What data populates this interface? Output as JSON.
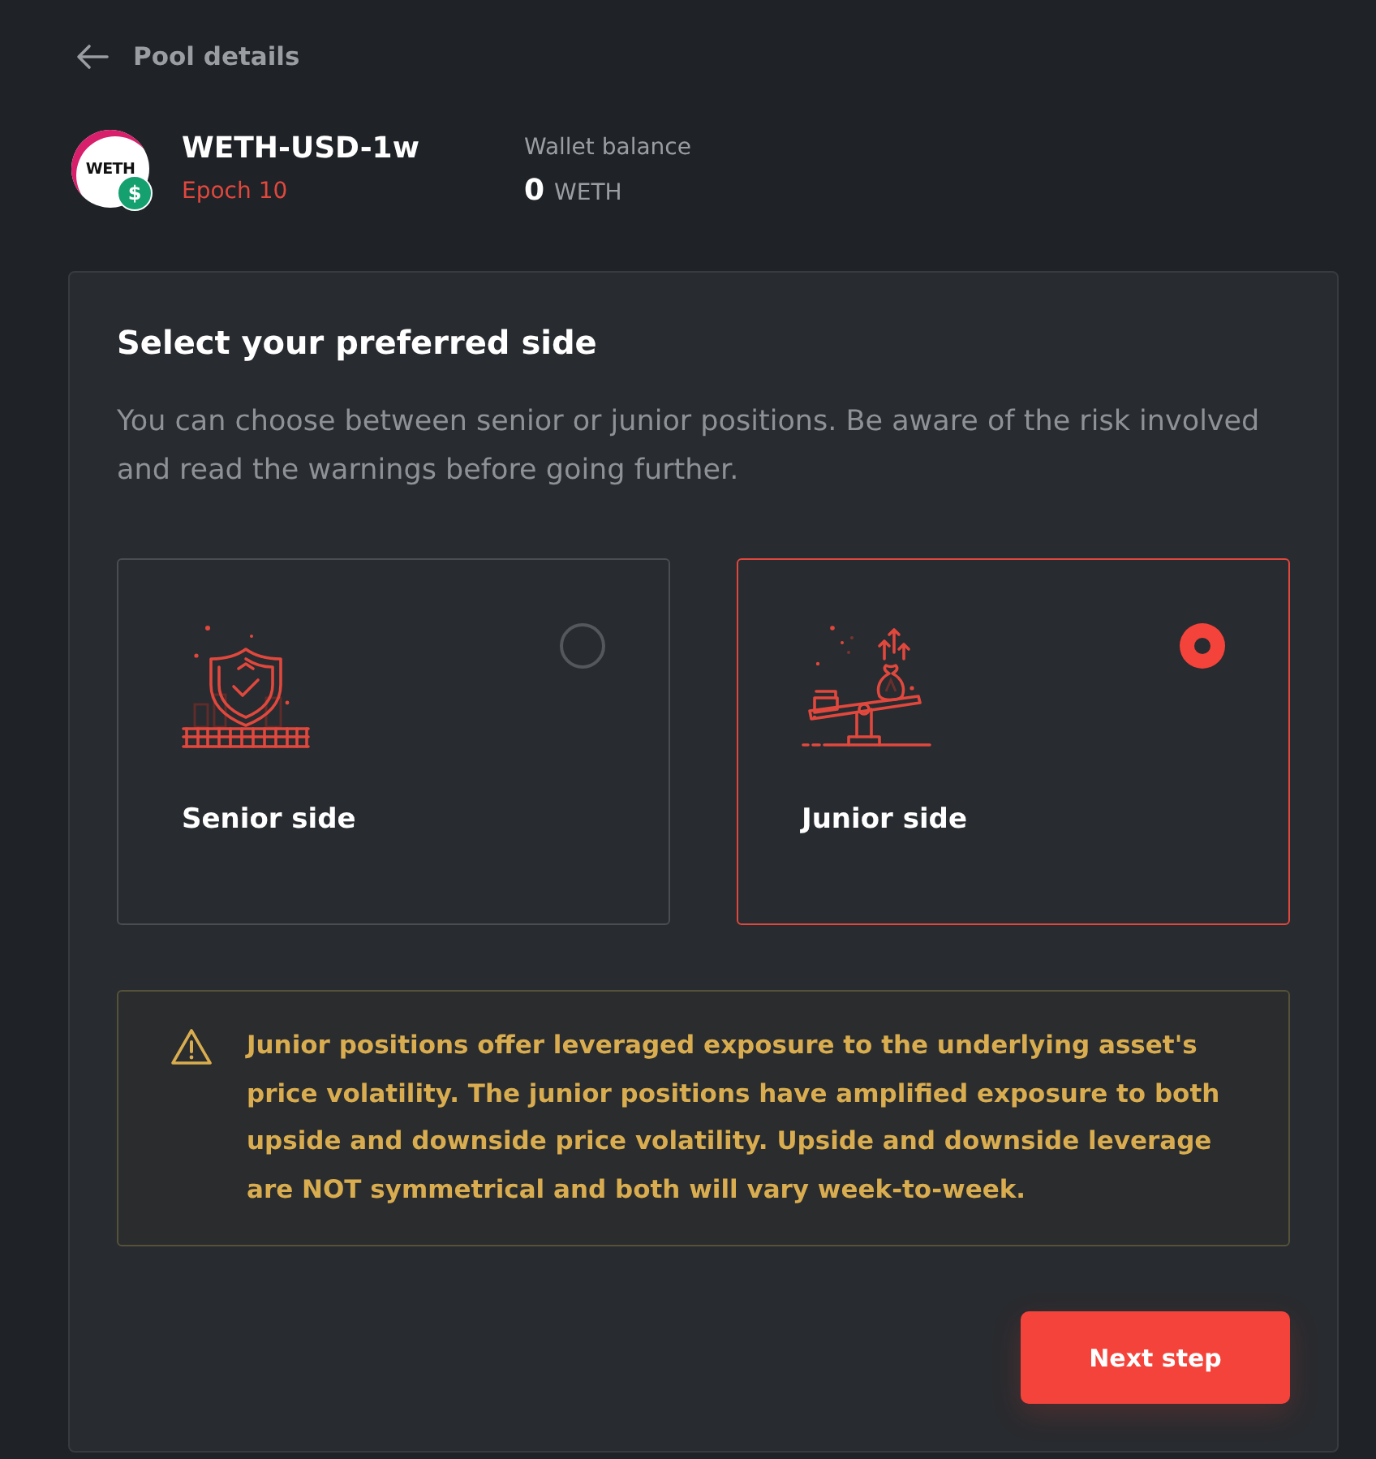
{
  "header": {
    "title": "Pool details"
  },
  "pool": {
    "logo_text": "WETH",
    "badge": "$",
    "name": "WETH-USD-1w",
    "epoch": "Epoch 10"
  },
  "wallet": {
    "label": "Wallet balance",
    "amount": "0",
    "unit": "WETH"
  },
  "panel": {
    "title": "Select your preferred side",
    "description": "You can choose between senior or junior positions. Be aware of the risk involved and read the warnings before going further.",
    "options": [
      {
        "kind": "senior",
        "label": "Senior side",
        "selected": false
      },
      {
        "kind": "junior",
        "label": "Junior side",
        "selected": true
      }
    ],
    "warning": {
      "text": "Junior positions offer leveraged exposure to the underlying asset's price volatility. The junior positions have amplified exposure to both upside and downside price volatility. Upside and downside leverage are NOT symmetrical and both will vary week-to-week."
    },
    "next_button": {
      "label": "Next step"
    }
  }
}
